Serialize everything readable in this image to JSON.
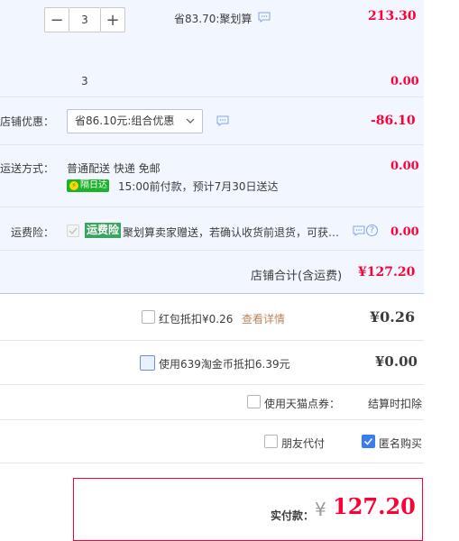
{
  "item": {
    "quantity": "3",
    "minus_label": "−",
    "plus_label": "+",
    "promo_note": "省83.70:聚划算",
    "subtotal": "213.30"
  },
  "bundle": {
    "quantity": "3",
    "price": "0.00"
  },
  "shop_discount": {
    "label": "店铺优惠：",
    "selected": "省86.10元:组合优惠",
    "amount": "-86.10"
  },
  "shipping": {
    "label": "运送方式：",
    "method": "普通配送 快递 免邮",
    "badge": "隔日达",
    "badge_icon": "⚡",
    "eta": "15:00前付款，预计7月30日送达",
    "price": "0.00"
  },
  "insurance": {
    "label": "运费险：",
    "badge": "运费险",
    "text": "聚划算卖家赠送，若确认收货前退货，可获…",
    "help_icon": "?",
    "price": "0.00"
  },
  "shop_total": {
    "label": "店铺合计(含运费)",
    "amount": "¥127.20"
  },
  "redpacket": {
    "label": "红包抵扣¥0.26",
    "link": "查看详情",
    "amount": "¥0.26"
  },
  "taojinbi": {
    "label": "使用639淘金币抵扣6.39元",
    "amount": "¥0.00"
  },
  "tmall_points": {
    "label": "使用天猫点券：",
    "note": "结算时扣除"
  },
  "options": {
    "friend_pay": "朋友代付",
    "anonymous": "匿名购买",
    "anonymous_checked": true
  },
  "payment": {
    "label": "实付款：",
    "currency": "¥",
    "amount": "127.20"
  },
  "colors": {
    "accent": "#ff0036",
    "section_bg": "#f2f7ff",
    "link": "#b7855c",
    "badge_green": "#1bb22c",
    "checkbox_blue": "#3b7ded"
  }
}
